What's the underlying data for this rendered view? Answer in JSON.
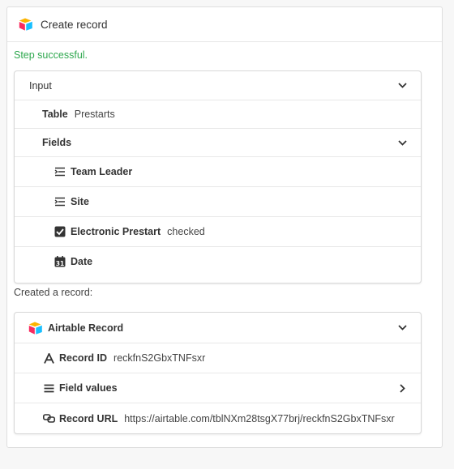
{
  "header": {
    "title": "Create record"
  },
  "status": "Step successful.",
  "input": {
    "label": "Input",
    "table_label": "Table",
    "table_value": "Prestarts",
    "fields_label": "Fields",
    "fields": [
      {
        "name": "Team Leader",
        "icon": "text-lines-icon",
        "value": ""
      },
      {
        "name": "Site",
        "icon": "text-lines-icon",
        "value": ""
      },
      {
        "name": "Electronic Prestart",
        "icon": "checkbox-checked-icon",
        "value": "checked"
      },
      {
        "name": "Date",
        "icon": "calendar-icon",
        "value": ""
      }
    ]
  },
  "created_label": "Created a record:",
  "record": {
    "label": "Airtable Record",
    "id_label": "Record ID",
    "id_value": "reckfnS2GbxTNFsxr",
    "field_values_label": "Field values",
    "url_label": "Record URL",
    "url_value": "https://airtable.com/tblNXm28tsgX77brj/reckfnS2GbxTNFsxr"
  },
  "colors": {
    "success": "#2fa84f",
    "text": "#333333",
    "border": "#d8d8d8"
  }
}
